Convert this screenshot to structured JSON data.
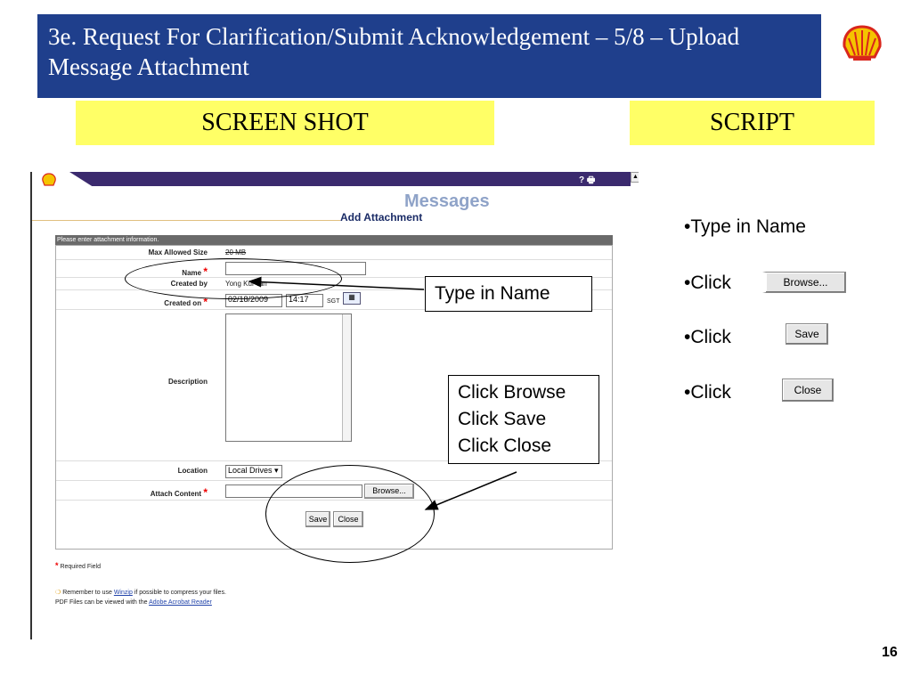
{
  "slide": {
    "title": "3e.  Request For Clarification/Submit Acknowledgement – 5/8 – Upload Message Attachment",
    "screenshot_label": "SCREEN SHOT",
    "script_label": "SCRIPT",
    "page_number": "16"
  },
  "app": {
    "banner_icons": "? 🖶",
    "messages_watermark": "Messages",
    "heading": "Add Attachment",
    "form_header": "Please enter attachment information.",
    "fields": {
      "max_size_label": "Max Allowed Size",
      "max_size_value": "20 MB",
      "name_label": "Name",
      "name_value": "",
      "created_by_label": "Created by",
      "created_by_value": "Yong Kui Tan",
      "created_on_label": "Created on",
      "created_on_date": "02/18/2009",
      "created_on_time": "14:17",
      "created_on_tz": "SGT",
      "description_label": "Description",
      "location_label": "Location",
      "location_value": "Local Drives",
      "attach_label": "Attach Content",
      "browse_label": "Browse...",
      "save_label": "Save",
      "close_label": "Close"
    },
    "required_field_note": "Required Field",
    "winzip_prefix": "Remember to use",
    "winzip_link": "Winzip",
    "winzip_suffix": "if possible to compress your files.",
    "pdf_prefix": "PDF Files can be viewed with the",
    "pdf_link": "Adobe Acrobat Reader"
  },
  "callouts": {
    "type_name": "Type in Name",
    "steps": [
      "Click Browse",
      "Click Save",
      "Click Close"
    ]
  },
  "script": {
    "items": [
      "•Type in Name",
      "•Click",
      "•Click",
      "•Click"
    ],
    "browse_button": "Browse...",
    "save_button": "Save",
    "close_button": "Close"
  },
  "colors": {
    "title_bg": "#1f3f8c",
    "label_bg": "#ffff66",
    "banner": "#3b2a6e"
  }
}
